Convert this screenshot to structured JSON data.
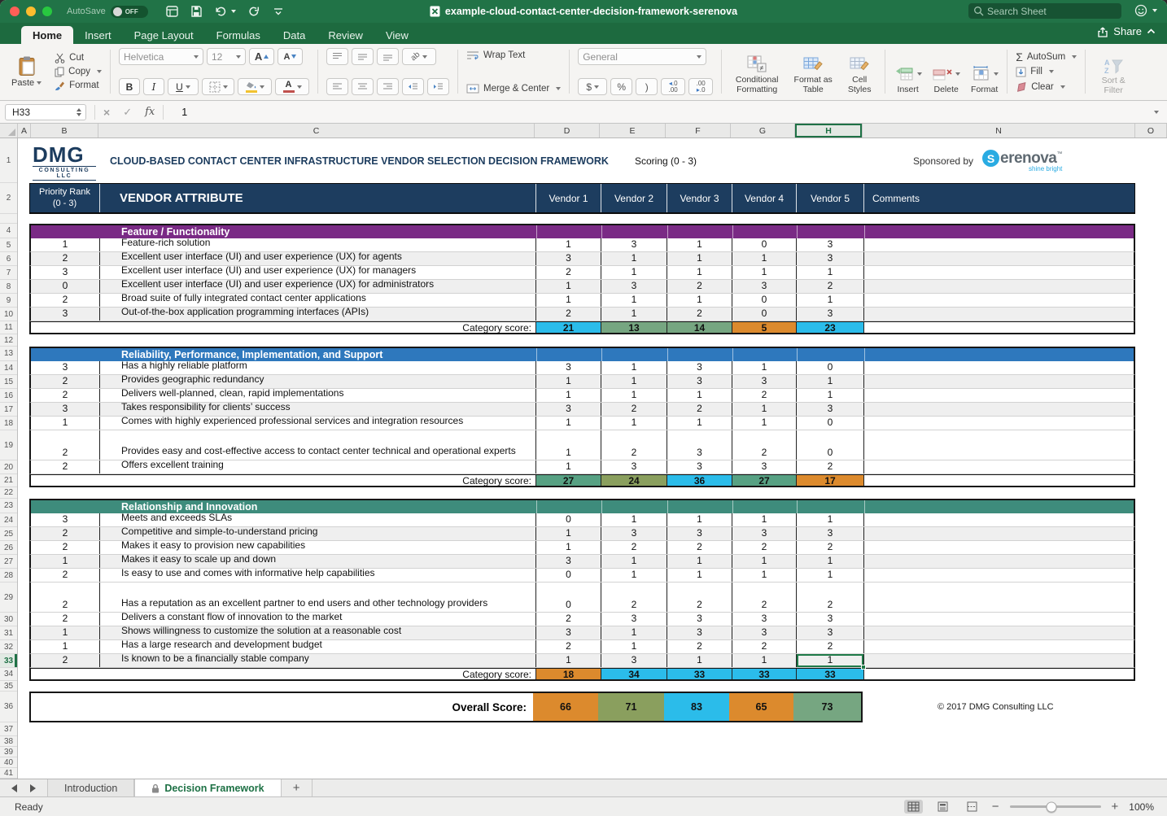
{
  "window": {
    "autosave_label": "AutoSave",
    "autosave_state": "OFF",
    "doc_title": "example-cloud-contact-center-decision-framework-serenova",
    "search_placeholder": "Search Sheet",
    "share_label": "Share"
  },
  "menu_tabs": [
    {
      "label": "Home",
      "active": true
    },
    {
      "label": "Insert"
    },
    {
      "label": "Page Layout"
    },
    {
      "label": "Formulas"
    },
    {
      "label": "Data"
    },
    {
      "label": "Review"
    },
    {
      "label": "View"
    }
  ],
  "ribbon": {
    "paste": "Paste",
    "cut": "Cut",
    "copy": "Copy",
    "format_painter": "Format",
    "font_name": "Helvetica",
    "font_size": "12",
    "bold": "B",
    "italic": "I",
    "underline": "U",
    "wrap_text": "Wrap Text",
    "merge_center": "Merge & Center",
    "number_format": "General",
    "currency": "$",
    "percent": "%",
    "comma": ")",
    "conditional_formatting": "Conditional Formatting",
    "format_as_table": "Format as Table",
    "cell_styles": "Cell Styles",
    "insert": "Insert",
    "delete": "Delete",
    "format_cells": "Format",
    "autosum": "AutoSum",
    "fill": "Fill",
    "clear": "Clear",
    "sort_filter": "Sort & Filter"
  },
  "formula_bar": {
    "name_box": "H33",
    "fx": "fx",
    "value": "1"
  },
  "sheet": {
    "columns": [
      "A",
      "B",
      "C",
      "D",
      "E",
      "F",
      "G",
      "H",
      "N",
      "O"
    ],
    "selected_column": "H",
    "active_row": 33,
    "gap_rows": [
      3,
      12,
      22,
      35
    ],
    "trailing_rows": [
      37,
      38,
      39,
      40,
      41
    ],
    "title_row": {
      "row": 1,
      "logo_main": "DMG",
      "logo_sub": "CONSULTING LLC",
      "title": "CLOUD-BASED CONTACT CENTER INFRASTRUCTURE VENDOR SELECTION DECISION FRAMEWORK",
      "scoring_label": "Scoring (0 - 3)",
      "sponsored_by": "Sponsored by",
      "sponsor_initial": "S",
      "sponsor_rest": "erenova",
      "sponsor_tm": "™",
      "sponsor_tagline": "shine bright"
    },
    "table_header": {
      "row": 2,
      "priority_line1": "Priority Rank",
      "priority_line2": "(0 - 3)",
      "attribute": "VENDOR ATTRIBUTE",
      "vendors": [
        "Vendor 1",
        "Vendor 2",
        "Vendor 3",
        "Vendor 4",
        "Vendor 5"
      ],
      "comments": "Comments"
    },
    "category_score_label": "Category score:",
    "sections": [
      {
        "name": "Feature / Functionality",
        "color": "#7a2a85",
        "header_row": 4,
        "score_row": 11,
        "rows": [
          {
            "row": 5,
            "priority": "1",
            "attribute": "Feature-rich solution",
            "scores": [
              1,
              3,
              1,
              0,
              3
            ]
          },
          {
            "row": 6,
            "priority": "2",
            "attribute": "Excellent user interface (UI) and user experience (UX) for agents",
            "scores": [
              3,
              1,
              1,
              1,
              3
            ]
          },
          {
            "row": 7,
            "priority": "3",
            "attribute": "Excellent user interface (UI) and user experience (UX) for managers",
            "scores": [
              2,
              1,
              1,
              1,
              1
            ]
          },
          {
            "row": 8,
            "priority": "0",
            "attribute": "Excellent user interface (UI) and user experience (UX) for administrators",
            "scores": [
              1,
              3,
              2,
              3,
              2
            ]
          },
          {
            "row": 9,
            "priority": "2",
            "attribute": "Broad suite of fully integrated contact center applications",
            "scores": [
              1,
              1,
              1,
              0,
              1
            ]
          },
          {
            "row": 10,
            "priority": "3",
            "attribute": "Out-of-the-box application programming interfaces (APIs)",
            "scores": [
              2,
              1,
              2,
              0,
              3
            ]
          }
        ],
        "category_scores": [
          {
            "value": 21,
            "color": "#2bbcea"
          },
          {
            "value": 13,
            "color": "#76a681"
          },
          {
            "value": 14,
            "color": "#76a681"
          },
          {
            "value": 5,
            "color": "#dc8a2d"
          },
          {
            "value": 23,
            "color": "#2bbcea"
          }
        ]
      },
      {
        "name": "Reliability, Performance, Implementation, and Support",
        "color": "#2e78bd",
        "header_row": 13,
        "score_row": 21,
        "rows": [
          {
            "row": 14,
            "priority": "3",
            "attribute": "Has a highly reliable platform",
            "scores": [
              3,
              1,
              3,
              1,
              0
            ]
          },
          {
            "row": 15,
            "priority": "2",
            "attribute": "Provides geographic redundancy",
            "scores": [
              1,
              1,
              3,
              3,
              1
            ]
          },
          {
            "row": 16,
            "priority": "2",
            "attribute": "Delivers well-planned, clean, rapid implementations",
            "scores": [
              1,
              1,
              1,
              2,
              1
            ]
          },
          {
            "row": 17,
            "priority": "3",
            "attribute": "Takes responsibility for clients’ success",
            "scores": [
              3,
              2,
              2,
              1,
              3
            ]
          },
          {
            "row": 18,
            "priority": "1",
            "attribute": "Comes with highly experienced professional services and integration resources",
            "scores": [
              1,
              1,
              1,
              1,
              0
            ]
          },
          {
            "row": 19,
            "priority": "2",
            "attribute": "Provides easy and cost-effective access to contact center technical and operational experts",
            "scores": [
              1,
              2,
              3,
              2,
              0
            ],
            "tall": true
          },
          {
            "row": 20,
            "priority": "2",
            "attribute": "Offers excellent training",
            "scores": [
              1,
              3,
              3,
              3,
              2
            ]
          }
        ],
        "category_scores": [
          {
            "value": 27,
            "color": "#57a183"
          },
          {
            "value": 24,
            "color": "#8a9f5e"
          },
          {
            "value": 36,
            "color": "#2bbcea"
          },
          {
            "value": 27,
            "color": "#57a183"
          },
          {
            "value": 17,
            "color": "#dc8a2d"
          }
        ]
      },
      {
        "name": "Relationship and Innovation",
        "color": "#3e8c7c",
        "header_row": 23,
        "score_row": 34,
        "rows": [
          {
            "row": 24,
            "priority": "3",
            "attribute": "Meets and exceeds SLAs",
            "scores": [
              0,
              1,
              1,
              1,
              1
            ]
          },
          {
            "row": 25,
            "priority": "2",
            "attribute": "Competitive and simple-to-understand pricing",
            "scores": [
              1,
              3,
              3,
              3,
              3
            ]
          },
          {
            "row": 26,
            "priority": "2",
            "attribute": "Makes it easy to provision new capabilities",
            "scores": [
              1,
              2,
              2,
              2,
              2
            ]
          },
          {
            "row": 27,
            "priority": "1",
            "attribute": "Makes it easy to scale up and down",
            "scores": [
              3,
              1,
              1,
              1,
              1
            ]
          },
          {
            "row": 28,
            "priority": "2",
            "attribute": "Is easy to use and comes with informative help capabilities",
            "scores": [
              0,
              1,
              1,
              1,
              1
            ]
          },
          {
            "row": 29,
            "priority": "2",
            "attribute": "Has a reputation as an excellent partner to end users and other technology providers",
            "scores": [
              0,
              2,
              2,
              2,
              2
            ],
            "tall": true
          },
          {
            "row": 30,
            "priority": "2",
            "attribute": "Delivers a constant flow of innovation to the market",
            "scores": [
              2,
              3,
              3,
              3,
              3
            ]
          },
          {
            "row": 31,
            "priority": "1",
            "attribute": "Shows willingness to customize the solution at a reasonable cost",
            "scores": [
              3,
              1,
              3,
              3,
              3
            ]
          },
          {
            "row": 32,
            "priority": "1",
            "attribute": "Has a large research and development budget",
            "scores": [
              2,
              1,
              2,
              2,
              2
            ]
          },
          {
            "row": 33,
            "priority": "2",
            "attribute": "Is known to be a financially stable company",
            "scores": [
              1,
              3,
              1,
              1,
              1
            ],
            "active_cell_col": 4
          }
        ],
        "category_scores": [
          {
            "value": 18,
            "color": "#dc8a2d"
          },
          {
            "value": 34,
            "color": "#2bbcea"
          },
          {
            "value": 33,
            "color": "#2bbcea"
          },
          {
            "value": 33,
            "color": "#2bbcea"
          },
          {
            "value": 33,
            "color": "#2bbcea"
          }
        ]
      }
    ],
    "overall": {
      "row": 36,
      "label": "Overall Score:",
      "scores": [
        {
          "value": 66,
          "color": "#dc8a2d"
        },
        {
          "value": 71,
          "color": "#8a9f5e"
        },
        {
          "value": 83,
          "color": "#2bbcea"
        },
        {
          "value": 65,
          "color": "#dc8a2d"
        },
        {
          "value": 73,
          "color": "#76a681"
        }
      ]
    },
    "copyright": "© 2017 DMG Consulting LLC"
  },
  "sheet_tabs": [
    {
      "label": "Introduction"
    },
    {
      "label": "Decision Framework",
      "active": true,
      "locked": true
    }
  ],
  "status_bar": {
    "ready": "Ready",
    "zoom": "100%"
  },
  "colors": {
    "accent_green": "#1e7145",
    "header_navy": "#1d3d5f"
  }
}
